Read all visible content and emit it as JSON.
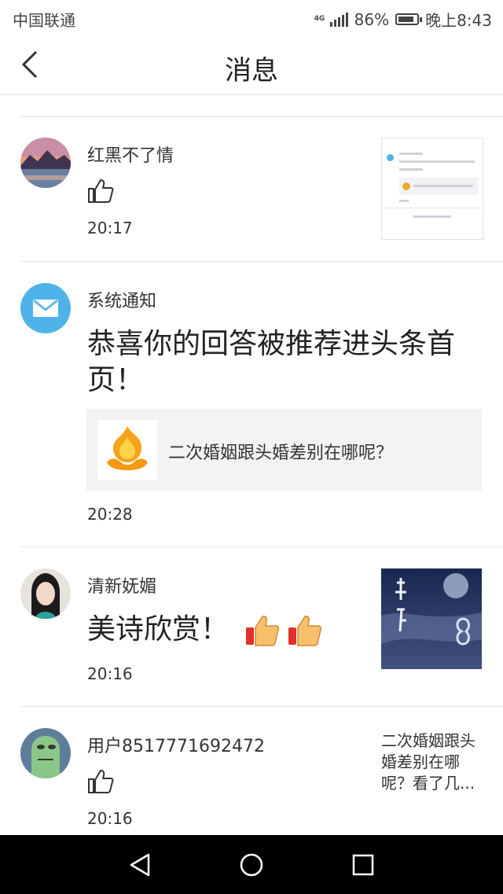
{
  "status_bar": {
    "carrier": "中国联通",
    "network": "4G",
    "battery": "86%",
    "battery_level": 0.86,
    "time": "晚上8:43"
  },
  "header": {
    "title": "消息",
    "back_icon": "chevron-left-icon"
  },
  "messages": [
    {
      "name": "红黑不了情",
      "time": "20:17",
      "content_icon": "thumbs-up-outline-icon",
      "preview_icon": "notification-screenshot"
    },
    {
      "name": "系统通知",
      "text": "恭喜你的回答被推荐进头条首页！",
      "card_text": "二次婚姻跟头婚差别在哪呢？",
      "time": "20:28",
      "avatar_icon": "mail-icon"
    },
    {
      "name": "清新妩媚",
      "text": "美诗欣赏！",
      "emoji_icon": "thumbs-up-emoji-icon",
      "time": "20:16",
      "preview_icon": "moon-poem-image"
    },
    {
      "name": "用户8517771692472",
      "time": "20:16",
      "content_icon": "thumbs-up-outline-icon",
      "preview_text": "二次婚姻跟头婚差别在哪呢？看了几..."
    }
  ],
  "nav_bar": {
    "back_icon": "triangle-back-icon",
    "home_icon": "circle-home-icon",
    "recents_icon": "square-recents-icon"
  },
  "colors": {
    "mail_avatar": "#4fb3ea",
    "divider": "#e6e6e6",
    "card_bg": "#f2f3f5"
  }
}
